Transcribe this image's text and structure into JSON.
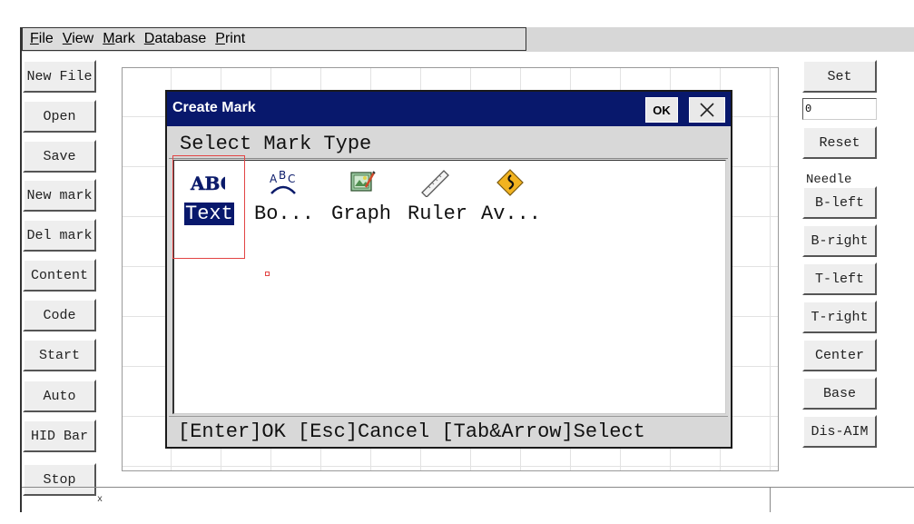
{
  "menu": {
    "items": [
      "File",
      "View",
      "Mark",
      "Database",
      "Print"
    ]
  },
  "left_toolbar": {
    "buttons": [
      "New File",
      "Open",
      "Save",
      "New mark",
      "Del mark",
      "Content",
      "Code",
      "Start",
      "Auto",
      "HID Bar",
      "Stop"
    ]
  },
  "right_toolbar": {
    "set_label": "Set",
    "value": "0",
    "reset_label": "Reset",
    "needle_label": "Needle",
    "buttons": [
      "B-left",
      "B-right",
      "T-left",
      "T-right",
      "Center",
      "Base",
      "Dis-AIM"
    ]
  },
  "dialog": {
    "title": "Create Mark",
    "ok_label": "OK",
    "header": "Select Mark Type",
    "mark_types": [
      {
        "label": "Text",
        "icon": "abc-text-icon",
        "selected": true
      },
      {
        "label": "Bo...",
        "icon": "arc-text-icon",
        "selected": false
      },
      {
        "label": "Graph",
        "icon": "graph-picture-icon",
        "selected": false
      },
      {
        "label": "Ruler",
        "icon": "ruler-icon",
        "selected": false
      },
      {
        "label": "Av...",
        "icon": "warning-curve-icon",
        "selected": false
      }
    ],
    "footer": "[Enter]OK [Esc]Cancel [Tab&Arrow]Select"
  },
  "status": {
    "mark": "x"
  },
  "colors": {
    "title_bar": "#08186c",
    "selection": "#08186c",
    "marker": "#e24444"
  }
}
